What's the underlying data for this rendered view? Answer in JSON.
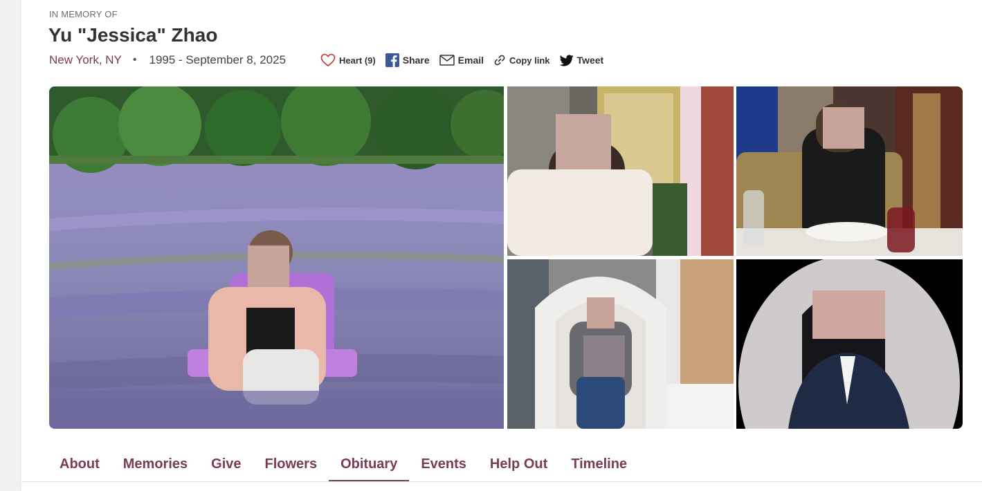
{
  "header": {
    "eyebrow": "IN MEMORY OF",
    "name": "Yu \"Jessica\" Zhao",
    "location": "New York, NY",
    "bullet": "•",
    "dates": "1995 - September 8, 2025"
  },
  "actions": {
    "heart_label": "Heart (9)",
    "share_label": "Share",
    "email_label": "Email",
    "copy_label": "Copy link",
    "tweet_label": "Tweet"
  },
  "colors": {
    "accent": "#7a3b55",
    "heart": "#c0392b",
    "facebook": "#3b5998"
  },
  "gallery": {
    "photos": [
      {
        "name": "photo-lavender-field"
      },
      {
        "name": "photo-storefront"
      },
      {
        "name": "photo-restaurant"
      },
      {
        "name": "photo-white-chair"
      },
      {
        "name": "photo-portrait"
      }
    ]
  },
  "tabs": [
    {
      "label": "About"
    },
    {
      "label": "Memories"
    },
    {
      "label": "Give"
    },
    {
      "label": "Flowers"
    },
    {
      "label": "Obituary",
      "active": true
    },
    {
      "label": "Events"
    },
    {
      "label": "Help Out"
    },
    {
      "label": "Timeline"
    }
  ]
}
